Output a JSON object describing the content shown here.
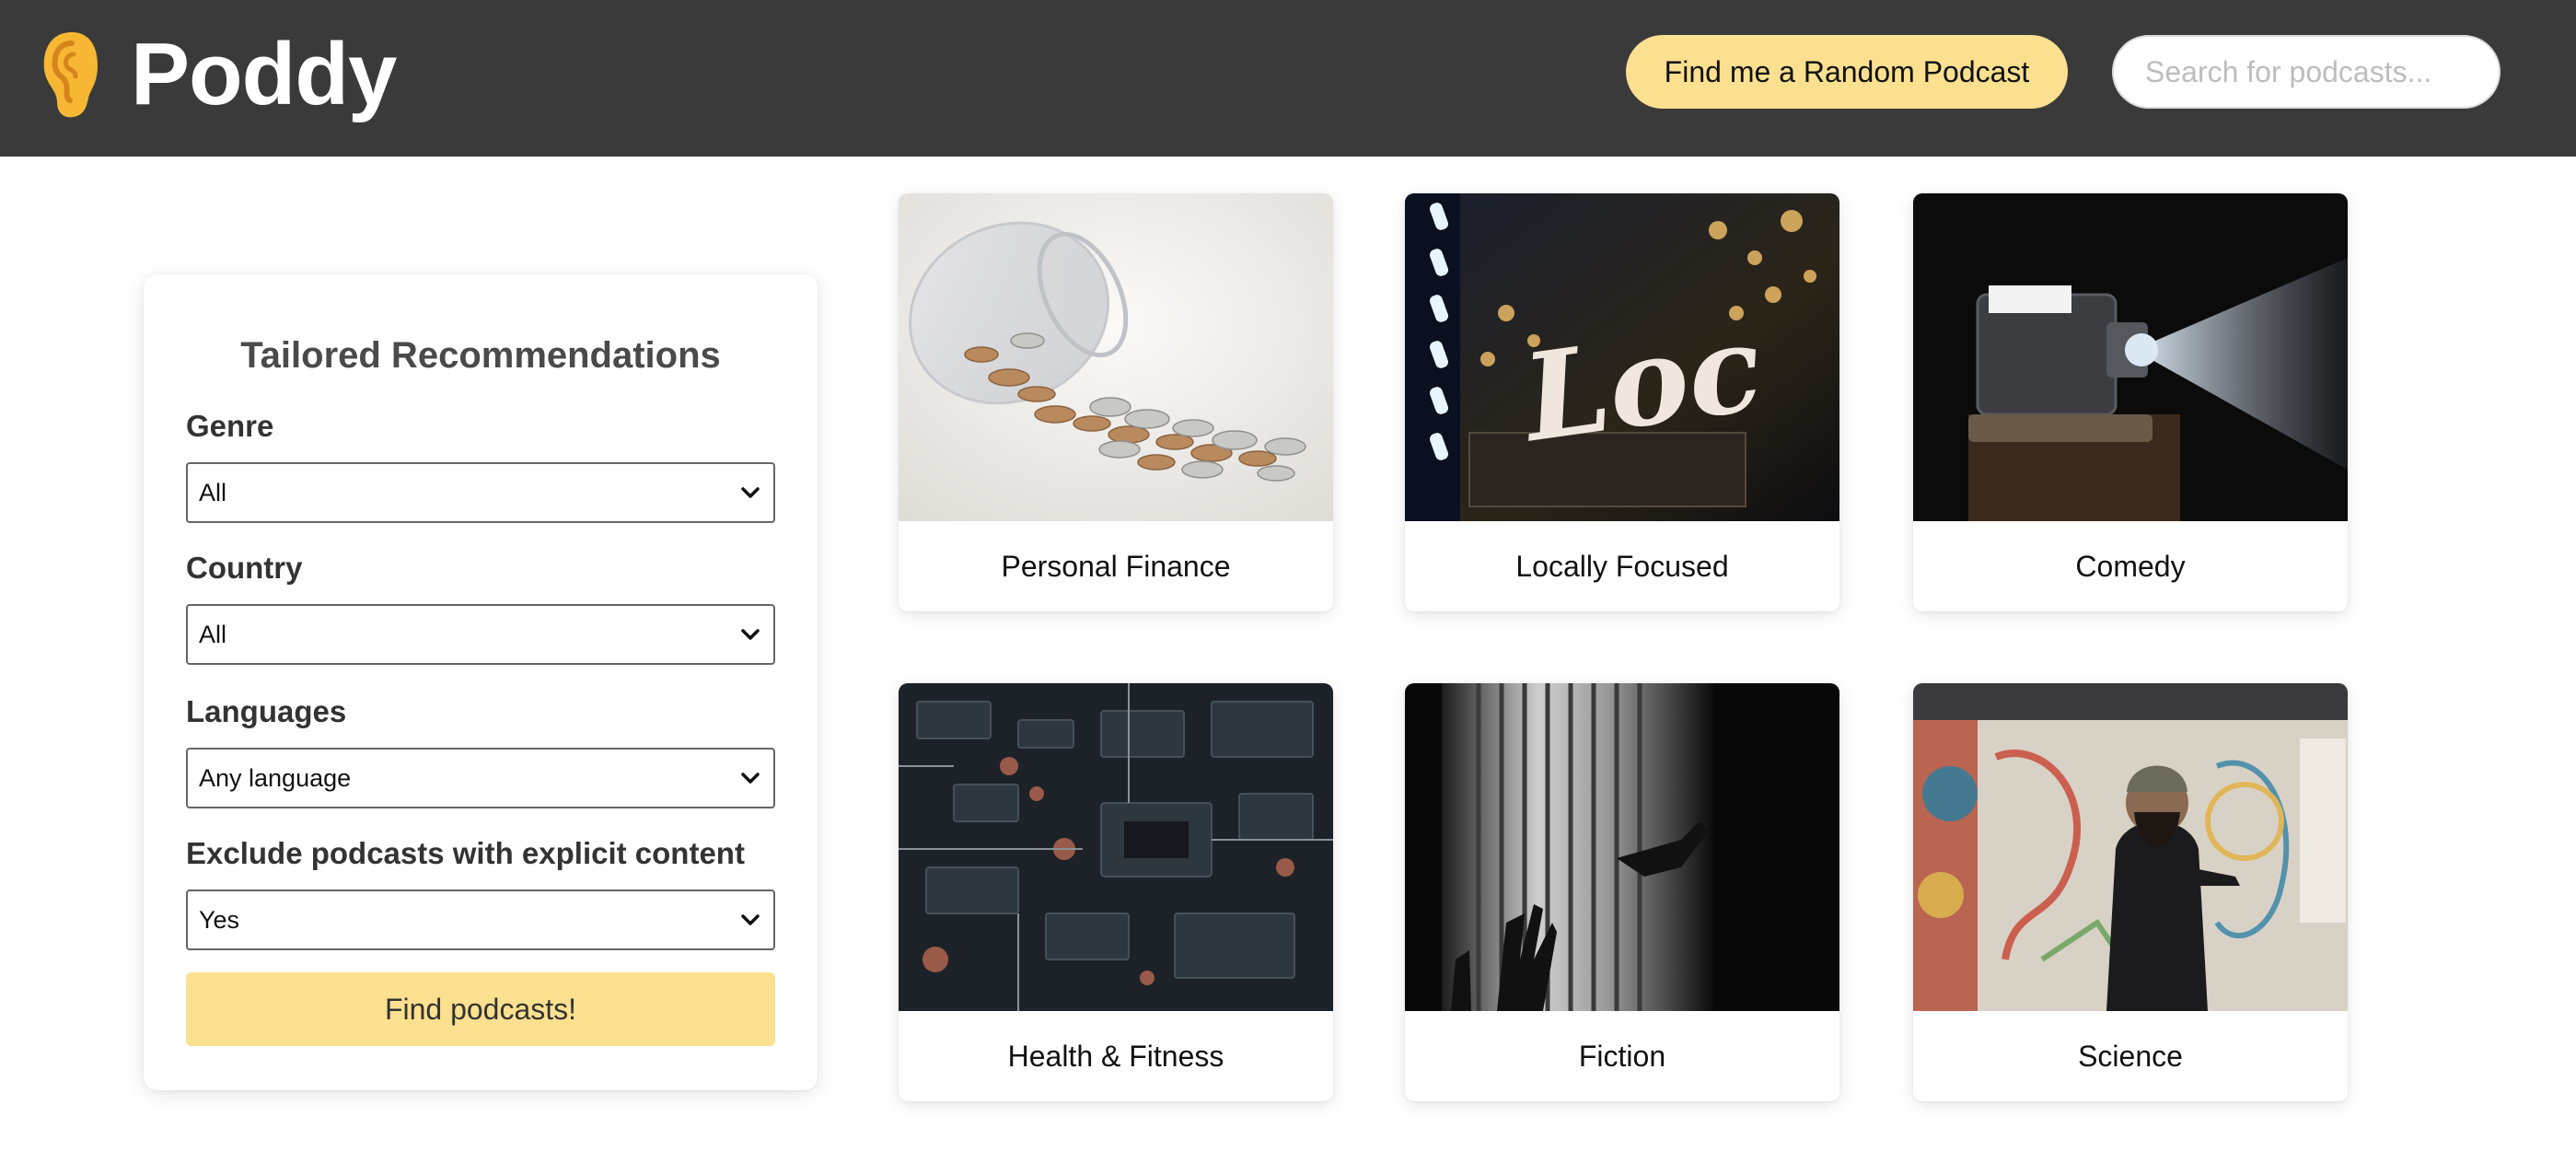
{
  "header": {
    "logo_text": "Poddy",
    "random_button": "Find me a Random Podcast",
    "search_placeholder": "Search for podcasts..."
  },
  "panel": {
    "title": "Tailored Recommendations",
    "fields": [
      {
        "label": "Genre",
        "value": "All"
      },
      {
        "label": "Country",
        "value": "All"
      },
      {
        "label": "Languages",
        "value": "Any language"
      },
      {
        "label": "Exclude podcasts with explicit content",
        "value": "Yes"
      }
    ],
    "submit": "Find podcasts!"
  },
  "categories": [
    {
      "label": "Personal Finance",
      "image": "coins-jar-photo"
    },
    {
      "label": "Locally Focused",
      "image": "local-sign-photo"
    },
    {
      "label": "Comedy",
      "image": "projector-photo"
    },
    {
      "label": "Health & Fitness",
      "image": "circuit-board-photo"
    },
    {
      "label": "Fiction",
      "image": "shadow-blinds-photo"
    },
    {
      "label": "Science",
      "image": "artist-mural-photo"
    }
  ],
  "colors": {
    "header_bg": "#3a3a3a",
    "accent": "#fbe08f"
  }
}
